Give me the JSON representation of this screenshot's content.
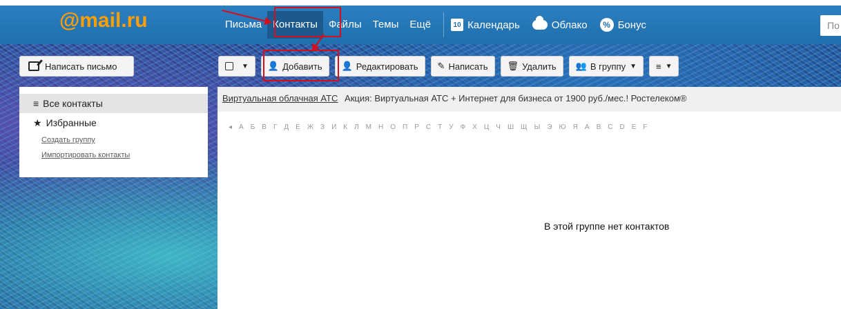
{
  "logo": {
    "text": "@mail.ru"
  },
  "nav": {
    "items": [
      "Письма",
      "Контакты",
      "Файлы",
      "Темы",
      "Ещё"
    ],
    "active": "Контакты",
    "calendar_day": "10",
    "calendar": "Календарь",
    "cloud": "Облако",
    "bonus": "Бонус",
    "search_placeholder": "По"
  },
  "compose": {
    "label": "Написать письмо"
  },
  "toolbar": {
    "add": "Добавить",
    "edit": "Редактировать",
    "write": "Написать",
    "delete": "Удалить",
    "to_group": "В группу"
  },
  "sidebar": {
    "all_contacts": "Все контакты",
    "favorites": "Избранные",
    "create_group": "Создать группу",
    "import_contacts": "Импортировать контакты"
  },
  "ad": {
    "link": "Виртуальная облачная АТС",
    "text": "Акция: Виртуальная АТС + Интернет для бизнеса от 1900 руб./мес.! Ростелеком®"
  },
  "alphabet": [
    "◂",
    "А",
    "Б",
    "В",
    "Г",
    "Д",
    "Е",
    "Ж",
    "З",
    "И",
    "К",
    "Л",
    "М",
    "Н",
    "О",
    "П",
    "Р",
    "С",
    "Т",
    "У",
    "Ф",
    "Х",
    "Ц",
    "Ч",
    "Ш",
    "Щ",
    "Ы",
    "Э",
    "Ю",
    "Я",
    "A",
    "B",
    "C",
    "D",
    "E",
    "F"
  ],
  "empty_message": "В этой группе нет контактов",
  "colors": {
    "topbar": "#1f6fae",
    "logo": "#ff9e00",
    "highlight": "#d60d1a"
  }
}
